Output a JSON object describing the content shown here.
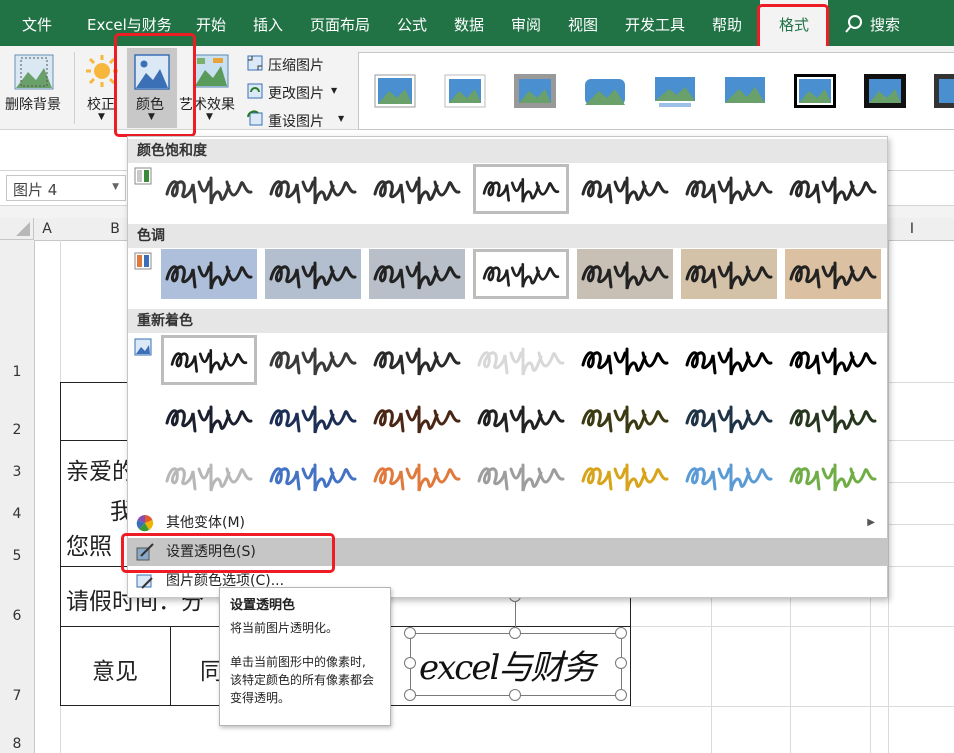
{
  "menu": {
    "tabs": [
      "文件",
      "Excel与财务",
      "开始",
      "插入",
      "页面布局",
      "公式",
      "数据",
      "审阅",
      "视图",
      "开发工具",
      "帮助",
      "格式"
    ],
    "search_label": "搜索"
  },
  "ribbon": {
    "remove_bg": "删除背景",
    "corrections": "校正",
    "color": "颜色",
    "artistic": "艺术效果",
    "compress": "压缩图片",
    "change": "更改图片",
    "reset": "重设图片"
  },
  "namebox": {
    "value": "图片 4"
  },
  "columns": [
    "A",
    "B",
    "I"
  ],
  "rows": [
    "1",
    "2",
    "3",
    "4",
    "5",
    "6",
    "7",
    "8"
  ],
  "cells": {
    "c3": "亲爱的",
    "c4": "我",
    "c5": "您照",
    "c6": "请假时间：分",
    "c7a": "意见",
    "c7b": "同"
  },
  "dropdown": {
    "section_saturation": "颜色饱和度",
    "section_tone": "色调",
    "section_recolor": "重新着色",
    "more_variants": "其他变体(M)",
    "set_transparent": "设置透明色(S)",
    "picture_color_options": "图片颜色选项(C)..."
  },
  "tooltip": {
    "title": "设置透明色",
    "line1": "将当前图片透明化。",
    "line2": "单击当前图形中的像素时, 该特定颜色的所有像素都会变得透明。"
  },
  "signature_text": "excel与财务",
  "colors": {
    "brand": "#217346",
    "highlight": "#ee1c25",
    "saturation": [
      "#3a3a3a",
      "#333333",
      "#2f2f2f",
      "#222222",
      "#2a2a2a",
      "#2c2c2c",
      "#282828"
    ],
    "tone_bg": [
      "#aebfdc",
      "#b3bfcf",
      "#b9bfc8",
      "#ffffff",
      "#c8c0b4",
      "#d3c1a8",
      "#dcc0a2"
    ],
    "recolor": [
      {
        "ink": "#1a1a1a",
        "bg": "#ffffff"
      },
      {
        "ink": "#3a3a3a",
        "bg": "#ffffff"
      },
      {
        "ink": "#2a2a2a",
        "bg": "#ffffff"
      },
      {
        "ink": "#d8d8d8",
        "bg": "#ffffff"
      },
      {
        "ink": "#000000",
        "bg": "#ffffff"
      },
      {
        "ink": "#000000",
        "bg": "#ffffff"
      },
      {
        "ink": "#000000",
        "bg": "#ffffff"
      },
      {
        "ink": "#1b1f2e",
        "bg": "#ffffff"
      },
      {
        "ink": "#1e2f55",
        "bg": "#ffffff"
      },
      {
        "ink": "#4a2616",
        "bg": "#ffffff"
      },
      {
        "ink": "#222222",
        "bg": "#ffffff"
      },
      {
        "ink": "#3b3a12",
        "bg": "#ffffff"
      },
      {
        "ink": "#1f3346",
        "bg": "#ffffff"
      },
      {
        "ink": "#27361e",
        "bg": "#ffffff"
      },
      {
        "ink": "#b7b7b7",
        "bg": "#ffffff"
      },
      {
        "ink": "#4472c4",
        "bg": "#ffffff"
      },
      {
        "ink": "#e07a3c",
        "bg": "#ffffff"
      },
      {
        "ink": "#9d9d9d",
        "bg": "#ffffff"
      },
      {
        "ink": "#d7a41b",
        "bg": "#ffffff"
      },
      {
        "ink": "#5b9bd5",
        "bg": "#ffffff"
      },
      {
        "ink": "#70ad47",
        "bg": "#ffffff"
      }
    ]
  }
}
